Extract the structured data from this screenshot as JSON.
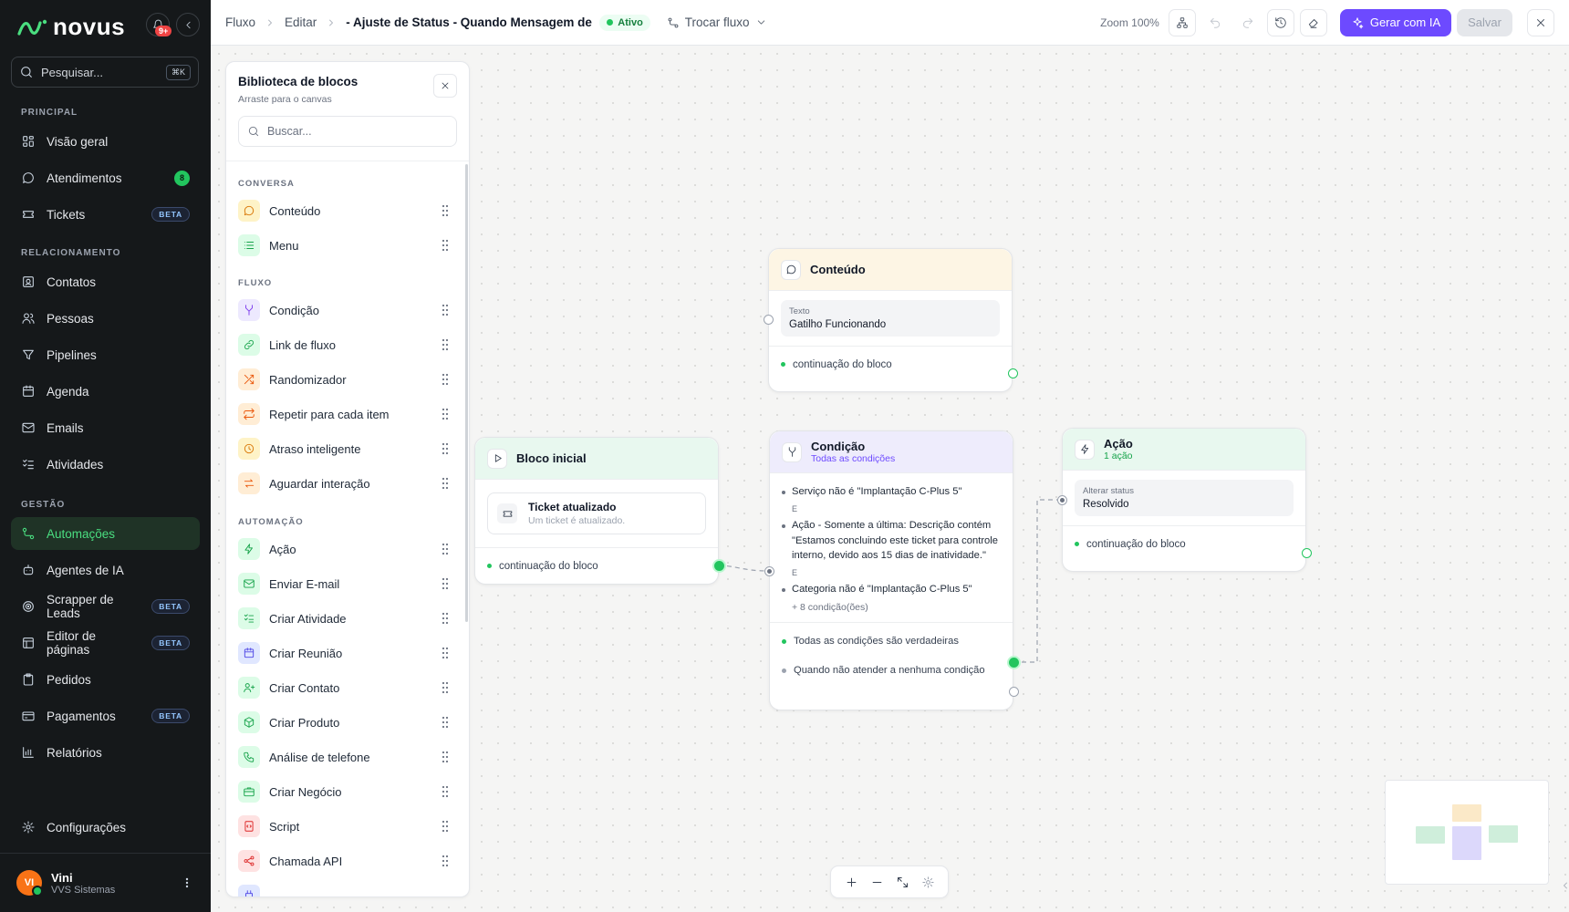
{
  "app": {
    "brand": "novus",
    "notifications_badge": "9+",
    "search_placeholder": "Pesquisar...",
    "search_shortcut": "⌘K"
  },
  "sidebar": {
    "sections": [
      {
        "label": "PRINCIPAL"
      },
      {
        "label": "RELACIONAMENTO"
      },
      {
        "label": "GESTÃO"
      }
    ],
    "items": [
      {
        "label": "Visão geral",
        "icon": "grid-icon"
      },
      {
        "label": "Atendimentos",
        "icon": "chat-icon",
        "count": "8"
      },
      {
        "label": "Tickets",
        "icon": "ticket-icon",
        "badge": "BETA"
      },
      {
        "label": "Contatos",
        "icon": "contact-card-icon"
      },
      {
        "label": "Pessoas",
        "icon": "users-icon"
      },
      {
        "label": "Pipelines",
        "icon": "filter-icon"
      },
      {
        "label": "Agenda",
        "icon": "calendar-icon"
      },
      {
        "label": "Emails",
        "icon": "mail-icon"
      },
      {
        "label": "Atividades",
        "icon": "checklist-icon"
      },
      {
        "label": "Automações",
        "icon": "workflow-icon",
        "active": true
      },
      {
        "label": "Agentes de IA",
        "icon": "bot-icon"
      },
      {
        "label": "Scrapper de Leads",
        "icon": "target-icon",
        "badge": "BETA"
      },
      {
        "label": "Editor de páginas",
        "icon": "layout-icon",
        "badge": "BETA"
      },
      {
        "label": "Pedidos",
        "icon": "clipboard-icon"
      },
      {
        "label": "Pagamentos",
        "icon": "credit-card-icon",
        "badge": "BETA"
      },
      {
        "label": "Relatórios",
        "icon": "bar-chart-icon"
      }
    ],
    "settings": "Configurações",
    "user": {
      "initials": "VI",
      "name": "Vini",
      "org": "VVS Sistemas"
    }
  },
  "topbar": {
    "breadcrumb": [
      "Fluxo",
      "Editar",
      "- Ajuste de Status - Quando Mensagem de in"
    ],
    "status": "Ativo",
    "switch_flow": "Trocar fluxo",
    "zoom": "Zoom 100%",
    "ai_button": "Gerar com IA",
    "save_button": "Salvar"
  },
  "library": {
    "title": "Biblioteca de blocos",
    "subtitle": "Arraste para o canvas",
    "search_placeholder": "Buscar...",
    "groups": [
      {
        "label": "CONVERSA",
        "items": [
          {
            "label": "Conteúdo",
            "icon": "message-icon",
            "color": "#d97706",
            "bg": "#fef3c7"
          },
          {
            "label": "Menu",
            "icon": "list-icon",
            "color": "#16a34a",
            "bg": "#dcfce7"
          }
        ]
      },
      {
        "label": "FLUXO",
        "items": [
          {
            "label": "Condição",
            "icon": "split-icon",
            "color": "#7c3aed",
            "bg": "#ede9fe"
          },
          {
            "label": "Link de fluxo",
            "icon": "link-icon",
            "color": "#16a34a",
            "bg": "#dcfce7"
          },
          {
            "label": "Randomizador",
            "icon": "shuffle-icon",
            "color": "#ea580c",
            "bg": "#ffedd5"
          },
          {
            "label": "Repetir para cada item",
            "icon": "repeat-icon",
            "color": "#ea580c",
            "bg": "#ffedd5"
          },
          {
            "label": "Atraso inteligente",
            "icon": "clock-icon",
            "color": "#d97706",
            "bg": "#fef3c7"
          },
          {
            "label": "Aguardar interação",
            "icon": "arrows-icon",
            "color": "#ea580c",
            "bg": "#ffedd5"
          }
        ]
      },
      {
        "label": "AUTOMAÇÃO",
        "items": [
          {
            "label": "Ação",
            "icon": "zap-icon",
            "color": "#16a34a",
            "bg": "#dcfce7"
          },
          {
            "label": "Enviar E-mail",
            "icon": "mail-icon",
            "color": "#16a34a",
            "bg": "#dcfce7"
          },
          {
            "label": "Criar Atividade",
            "icon": "checklist-icon",
            "color": "#16a34a",
            "bg": "#dcfce7"
          },
          {
            "label": "Criar Reunião",
            "icon": "calendar-icon",
            "color": "#4f46e5",
            "bg": "#e0e7ff"
          },
          {
            "label": "Criar Contato",
            "icon": "user-plus-icon",
            "color": "#16a34a",
            "bg": "#dcfce7"
          },
          {
            "label": "Criar Produto",
            "icon": "box-icon",
            "color": "#16a34a",
            "bg": "#dcfce7"
          },
          {
            "label": "Análise de telefone",
            "icon": "phone-icon",
            "color": "#16a34a",
            "bg": "#dcfce7"
          },
          {
            "label": "Criar Negócio",
            "icon": "briefcase-icon",
            "color": "#16a34a",
            "bg": "#dcfce7"
          },
          {
            "label": "Script",
            "icon": "code-icon",
            "color": "#dc2626",
            "bg": "#fee2e2"
          },
          {
            "label": "Chamada API",
            "icon": "share-icon",
            "color": "#dc2626",
            "bg": "#fee2e2"
          }
        ]
      }
    ]
  },
  "nodes": {
    "content": {
      "title": "Conteúdo",
      "field_label": "Texto",
      "field_value": "Gatilho Funcionando",
      "footer": "continuação do bloco",
      "head_color": "#fdf5e4"
    },
    "start": {
      "title": "Bloco inicial",
      "trigger_title": "Ticket atualizado",
      "trigger_sub": "Um ticket é atualizado.",
      "footer": "continuação do bloco",
      "head_color": "#e8f8ef"
    },
    "condition": {
      "title": "Condição",
      "subtitle": "Todas as condições",
      "head_color": "#eeecfc",
      "rules": [
        "Serviço não é \"Implantação C-Plus 5\"",
        "Ação - Somente a última: Descrição contém \"Estamos concluindo este ticket para controle interno, devido aos 15 dias de inatividade.\"",
        "Categoria não é \"Implantação C-Plus 5\""
      ],
      "joiner": "E",
      "more": "+ 8 condição(ões)",
      "out_true": "Todas as condições são verdadeiras",
      "out_false": "Quando não atender a nenhuma condição"
    },
    "action": {
      "title": "Ação",
      "subtitle": "1 ação",
      "field_label": "Alterar status",
      "field_value": "Resolvido",
      "footer": "continuação do bloco",
      "head_color": "#e8f8ef"
    }
  },
  "colors": {
    "accent": "#22c55e",
    "brand": "#6d4aff",
    "sidebar_bg": "#15181a"
  }
}
